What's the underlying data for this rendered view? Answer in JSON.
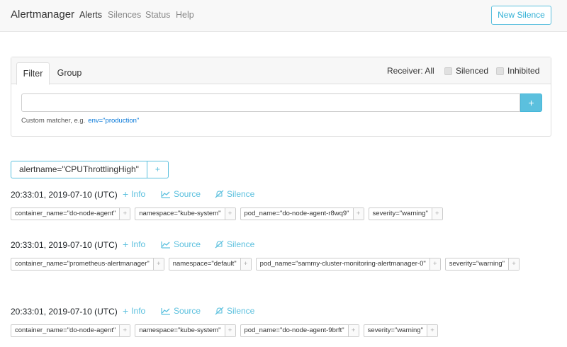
{
  "navbar": {
    "brand": "Alertmanager",
    "links": [
      "Alerts",
      "Silences",
      "Status",
      "Help"
    ],
    "new_silence": "New Silence"
  },
  "filter": {
    "tabs": [
      "Filter",
      "Group"
    ],
    "receiver": "Receiver: All",
    "silenced": "Silenced",
    "inhibited": "Inhibited",
    "input_value": "",
    "add": "+",
    "hint": "Custom matcher, e.g.",
    "hint_example": "env=\"production\""
  },
  "group": {
    "label": "alertname=\"CPUThrottlingHigh\"",
    "plus": "+"
  },
  "actions": {
    "info": "Info",
    "source": "Source",
    "silence": "Silence"
  },
  "alerts": [
    {
      "timestamp": "20:33:01, 2019-07-10 (UTC)",
      "labels": [
        "container_name=\"do-node-agent\"",
        "namespace=\"kube-system\"",
        "pod_name=\"do-node-agent-r8wq9\"",
        "severity=\"warning\""
      ]
    },
    {
      "timestamp": "20:33:01, 2019-07-10 (UTC)",
      "labels": [
        "container_name=\"prometheus-alertmanager\"",
        "namespace=\"default\"",
        "pod_name=\"sammy-cluster-monitoring-alertmanager-0\"",
        "severity=\"warning\""
      ]
    },
    {
      "timestamp": "20:33:01, 2019-07-10 (UTC)",
      "labels": [
        "container_name=\"do-node-agent\"",
        "namespace=\"kube-system\"",
        "pod_name=\"do-node-agent-9brft\"",
        "severity=\"warning\""
      ]
    }
  ],
  "colors": {
    "accent": "#5bc0de",
    "link": "#0275d8"
  }
}
